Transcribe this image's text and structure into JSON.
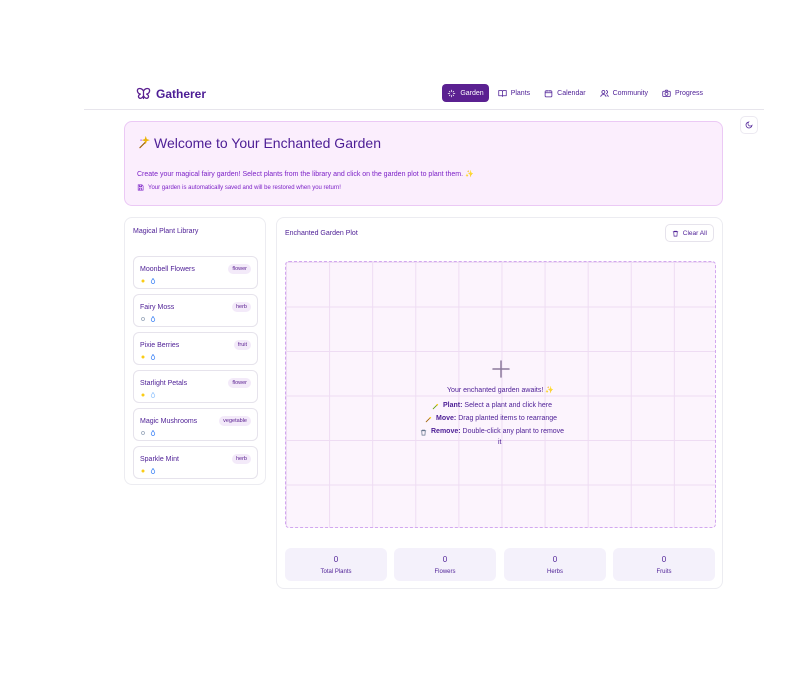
{
  "app": {
    "name": "Gatherer"
  },
  "nav": [
    {
      "label": "Garden",
      "icon": "sparkles-icon",
      "active": true
    },
    {
      "label": "Plants",
      "icon": "book-icon",
      "active": false
    },
    {
      "label": "Calendar",
      "icon": "calendar-icon",
      "active": false
    },
    {
      "label": "Community",
      "icon": "users-icon",
      "active": false
    },
    {
      "label": "Progress",
      "icon": "camera-icon",
      "active": false
    }
  ],
  "welcome": {
    "title": "Welcome to Your Enchanted Garden",
    "subtitle": "Create your magical fairy garden! Select plants from the library and click on the garden plot to plant them. ✨",
    "note": "Your garden is automatically saved and will be restored when you return!"
  },
  "library": {
    "title": "Magical Plant Library",
    "plants": [
      {
        "name": "Moonbell Flowers",
        "type": "flower"
      },
      {
        "name": "Fairy Moss",
        "type": "herb"
      },
      {
        "name": "Pixie Berries",
        "type": "fruit"
      },
      {
        "name": "Starlight Petals",
        "type": "flower"
      },
      {
        "name": "Magic Mushrooms",
        "type": "vegetable"
      },
      {
        "name": "Sparkle Mint",
        "type": "herb"
      }
    ]
  },
  "plot": {
    "title": "Enchanted Garden Plot",
    "clear_label": "Clear All",
    "empty_title": "Your enchanted garden awaits! ✨",
    "plant_label": "Plant:",
    "plant_text": "Select a plant and click here",
    "move_label": "Move:",
    "move_text": "Drag planted items to rearrange",
    "remove_label": "Remove:",
    "remove_text": "Double-click any plant to remove",
    "remove_text_2": "it"
  },
  "stats": [
    {
      "value": "0",
      "label": "Total Plants"
    },
    {
      "value": "0",
      "label": "Flowers"
    },
    {
      "value": "0",
      "label": "Herbs"
    },
    {
      "value": "0",
      "label": "Fruits"
    }
  ],
  "colors": {
    "accent": "#5b2191",
    "banner": "#fbeefd",
    "text": "#4c1d95"
  }
}
